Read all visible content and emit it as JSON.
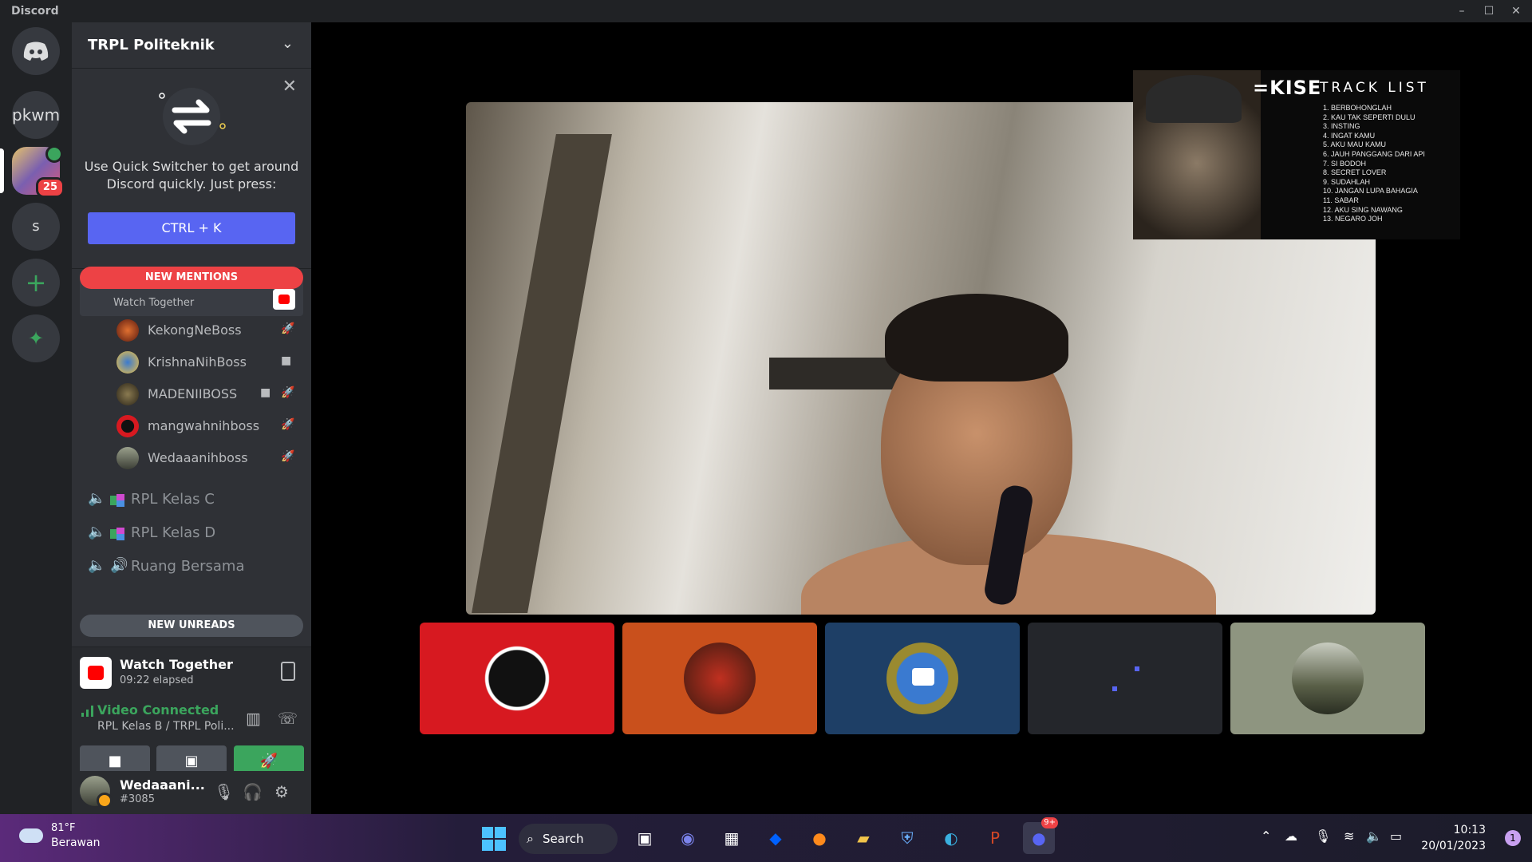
{
  "window": {
    "app_name": "Discord",
    "min": "–",
    "max": "☐",
    "close": "✕"
  },
  "rail": {
    "servers": [
      {
        "label": "pkwm"
      },
      {
        "label": "",
        "badge": "25"
      },
      {
        "label": "s"
      }
    ],
    "add_label": "+",
    "explore_label": "✦"
  },
  "sidebar": {
    "server_name": "TRPL Politeknik",
    "quick_switcher": {
      "text": "Use Quick Switcher to get around Discord quickly. Just press:",
      "shortcut": "CTRL + K"
    },
    "new_mentions": "NEW MENTIONS",
    "active_channel": {
      "subtitle": "Watch Together"
    },
    "users": [
      {
        "name": "KekongNeBoss",
        "icons": [
          "🚀"
        ]
      },
      {
        "name": "KrishnaNihBoss",
        "icons": [
          "■"
        ]
      },
      {
        "name": "MADENIIBOSS",
        "icons": [
          "■",
          "🚀"
        ]
      },
      {
        "name": "mangwahnihboss",
        "icons": [
          "🚀"
        ]
      },
      {
        "name": "Wedaaanihboss",
        "icons": [
          "🚀"
        ]
      }
    ],
    "channels": [
      {
        "name": "RPL Kelas C"
      },
      {
        "name": "RPL Kelas D"
      },
      {
        "name": "Ruang Bersama"
      }
    ],
    "new_unreads": "NEW UNREADS",
    "activity": {
      "title": "Watch Together",
      "elapsed": "09:22 elapsed"
    },
    "voice": {
      "status": "Video Connected",
      "location": "RPL Kelas B / TRPL Poli..."
    },
    "me": {
      "name": "Wedaaani...",
      "tag": "#3085"
    }
  },
  "stage": {
    "album": {
      "logo": "=KISE",
      "heading": "TRACK LIST",
      "tracks": [
        "1. BERBOHONGLAH",
        "2. KAU TAK SEPERTI DULU",
        "3. INSTING",
        "4. INGAT KAMU",
        "5. AKU MAU KAMU",
        "6. JAUH PANGGANG DARI API",
        "7. SI BODOH",
        "8. SECRET LOVER",
        "9. SUDAHLAH",
        "10. JANGAN LUPA BAHAGIA",
        "11. SABAR",
        "12. AKU SING NAWANG",
        "13. NEGARO JOH"
      ]
    },
    "tiles": [
      {
        "bg": "#d71920"
      },
      {
        "bg": "#c9501c"
      },
      {
        "bg": "#1e3f66"
      },
      {
        "bg": "#24262b"
      },
      {
        "bg": "#8e9580"
      }
    ]
  },
  "taskbar": {
    "temp": "81°F",
    "condition": "Berawan",
    "search": "Search",
    "time": "10:13",
    "date": "20/01/2023",
    "notifications": "1",
    "discord_badge": "9+"
  },
  "colors": {
    "blurple": "#5865f2",
    "green": "#3ba55d",
    "red": "#ed4245"
  }
}
